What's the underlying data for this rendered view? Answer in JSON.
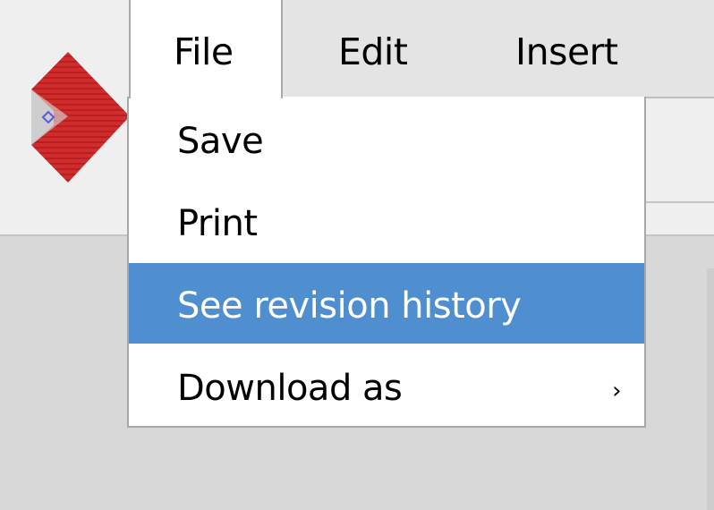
{
  "app": {
    "logo_icon": "app-logo-icon",
    "brand_color": "#d02c2c"
  },
  "menubar": {
    "items": [
      {
        "label": "File",
        "active": true
      },
      {
        "label": "Edit",
        "active": false
      },
      {
        "label": "Insert",
        "active": false
      }
    ]
  },
  "file_menu": {
    "items": [
      {
        "label": "Save",
        "highlighted": false
      },
      {
        "label": "Print",
        "highlighted": false
      },
      {
        "label": "See revision history",
        "highlighted": true
      },
      {
        "label": "Download as",
        "highlighted": false,
        "submenu_indicator": "›"
      }
    ],
    "highlight_color": "#4f8ecf"
  }
}
